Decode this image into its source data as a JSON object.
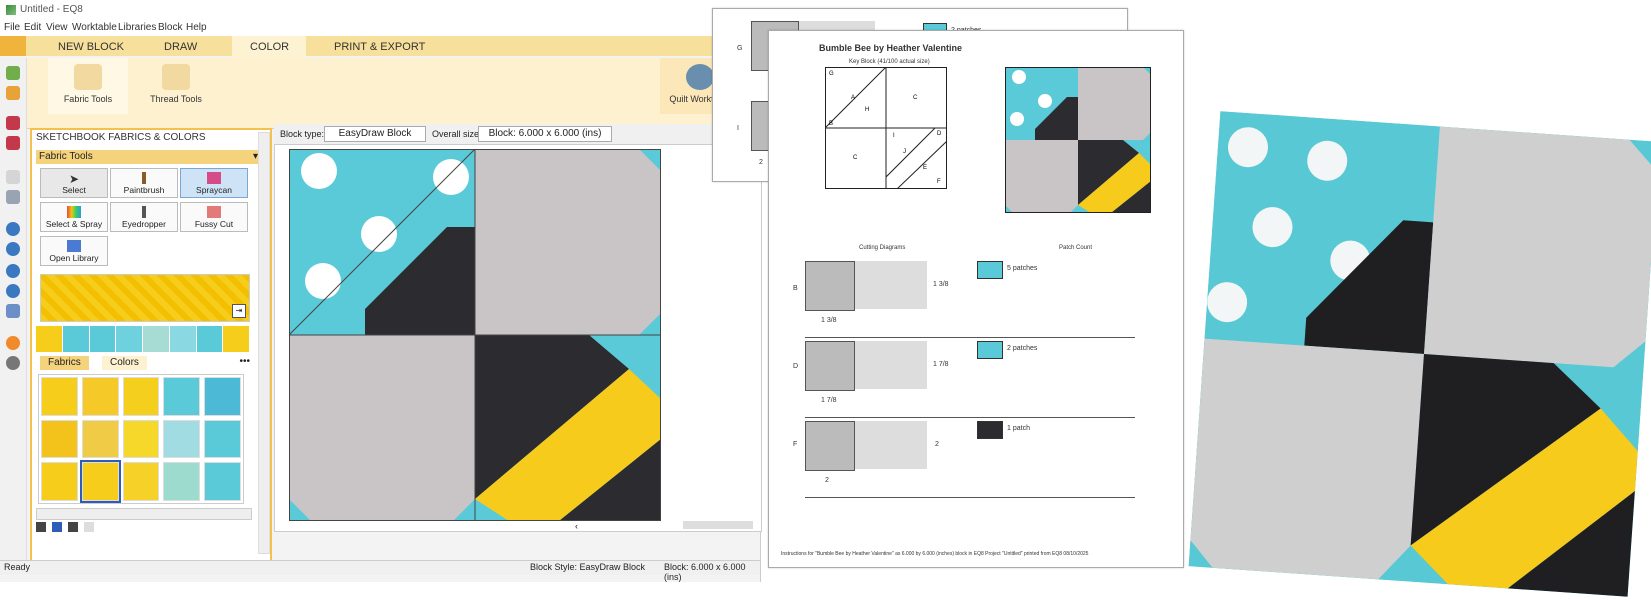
{
  "window": {
    "title": "Untitled - EQ8"
  },
  "menu": [
    "File",
    "Edit",
    "View",
    "Worktable",
    "Libraries",
    "Block",
    "Help"
  ],
  "ribbon_tabs": [
    {
      "label": "NEW BLOCK",
      "active": false
    },
    {
      "label": "DRAW",
      "active": false
    },
    {
      "label": "COLOR",
      "active": true
    },
    {
      "label": "PRINT & EXPORT",
      "active": false
    }
  ],
  "ribbon_buttons": {
    "fabric_tools": "Fabric Tools",
    "thread_tools": "Thread Tools",
    "quilt_worktable": "Quilt Worktable"
  },
  "panel": {
    "title": "SKETCHBOOK FABRICS & COLORS",
    "section": "Fabric Tools",
    "tools": [
      "Select",
      "Paintbrush",
      "Spraycan",
      "Select & Spray",
      "Eyedropper",
      "Fussy Cut",
      "Open Library"
    ],
    "tabs": [
      "Fabrics",
      "Colors"
    ],
    "more": "•••"
  },
  "blockbar": {
    "block_type_label": "Block type:",
    "block_type_value": "EasyDraw Block",
    "overall_size_label": "Overall size:",
    "overall_size_value": "Block: 6.000 x 6.000 (ins)"
  },
  "status": {
    "ready": "Ready",
    "block_style": "Block Style: EasyDraw Block",
    "block_size": "Block: 6.000 x 6.000 (ins)"
  },
  "printout": {
    "title": "Bumble Bee by Heather Valentine",
    "key_block": "Key Block (41/100 actual size)",
    "cutting": "Cutting Diagrams",
    "patch_count": "Patch Count",
    "rows": [
      {
        "letter": "B",
        "size": "1 3/8",
        "count": "5 patches"
      },
      {
        "letter": "D",
        "size": "1 7/8",
        "count": "2 patches"
      },
      {
        "letter": "F",
        "size": "2",
        "count": "1 patch"
      }
    ],
    "footer": "Instructions for \"Bumble Bee by Heather Valentine\" as 6.000 by 6.000 (inches) block in EQ8 Project \"Untitled\" printed from EQ8 08/10/2025",
    "key_labels": [
      "A",
      "H",
      "C",
      "C",
      "I",
      "J",
      "E",
      "D",
      "F",
      "B",
      "G"
    ]
  },
  "back_page": {
    "letters": [
      "G",
      "I"
    ],
    "size": "2",
    "patches": "2 patches"
  },
  "colors": {
    "aqua": "#5bcad8",
    "grey": "#c9c5c7",
    "black": "#2b2b30",
    "yellow": "#f6cb1c",
    "accent": "#f2c14e"
  }
}
